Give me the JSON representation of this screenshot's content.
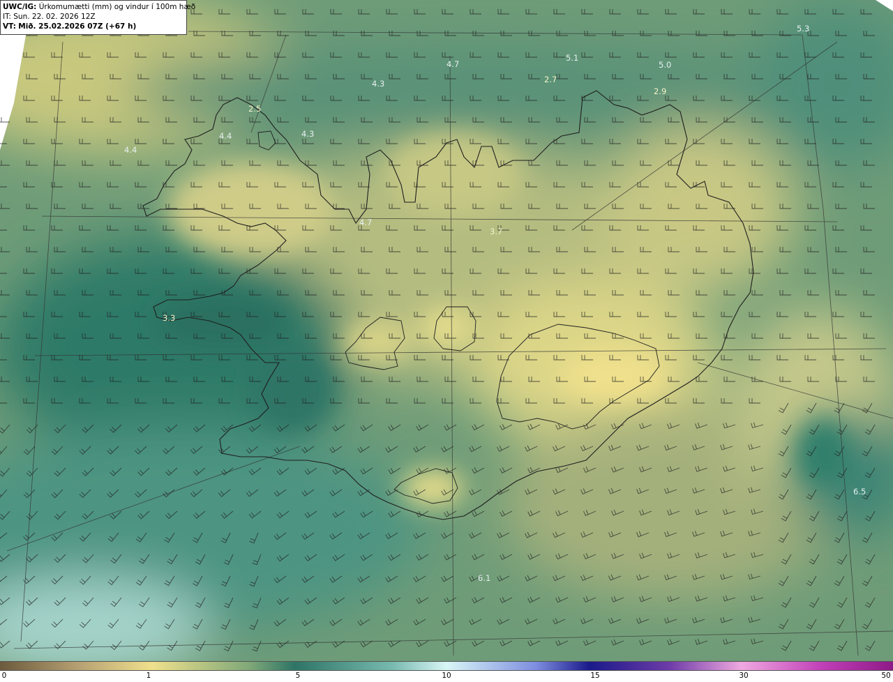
{
  "header": {
    "product": "UWC/IG:",
    "title": "Úrkomumætti (mm) og vindur í 100m hæð",
    "it_label": "IT:",
    "it_value": "Sun. 22. 02. 2026 12Z",
    "vt_label": "VT:",
    "vt_value": "Mið. 25.02.2026 07Z (+67 h)"
  },
  "map": {
    "variable": "precipitable water (mm)",
    "overlay": "wind barbs at 100m",
    "field_colors": {
      "low_dry": "#d9d488",
      "mid": "#8fae78",
      "moist": "#2f7f6c",
      "very_moist": "#cfeeee"
    },
    "coastline_color": "#222222",
    "value_labels": [
      {
        "text": "5.3",
        "color": "#e6f0f0"
      },
      {
        "text": "5.1",
        "color": "#e6f0f0"
      },
      {
        "text": "4.7",
        "color": "#e6f0f0"
      },
      {
        "text": "5.0",
        "color": "#e6f0f0"
      },
      {
        "text": "2.7",
        "color": "#f5f2c8"
      },
      {
        "text": "2.9",
        "color": "#f5f2c8"
      },
      {
        "text": "4.3",
        "color": "#e6f0f0"
      },
      {
        "text": "2.5",
        "color": "#f5f2c8"
      },
      {
        "text": "4.4",
        "color": "#e6f0f0"
      },
      {
        "text": "4.4",
        "color": "#e6f0f0"
      },
      {
        "text": "4.3",
        "color": "#e6f0f0"
      },
      {
        "text": "4.7",
        "color": "#e6f0f0"
      },
      {
        "text": "3.7",
        "color": "#f5f2c8"
      },
      {
        "text": "3.3",
        "color": "#f5f2c8"
      },
      {
        "text": "6.5",
        "color": "#e6f0f0"
      },
      {
        "text": "6.1",
        "color": "#e6f0f0"
      }
    ]
  },
  "colorbar": {
    "ticks": [
      "0",
      "1",
      "5",
      "10",
      "15",
      "30",
      "50"
    ],
    "stops": [
      {
        "color": "#6b5a3c",
        "frac": 0.0
      },
      {
        "color": "#b8a274",
        "frac": 0.09
      },
      {
        "color": "#efe08c",
        "frac": 0.17
      },
      {
        "color": "#7fa878",
        "frac": 0.28
      },
      {
        "color": "#2e7566",
        "frac": 0.33
      },
      {
        "color": "#78bab0",
        "frac": 0.44
      },
      {
        "color": "#d8f6f6",
        "frac": 0.5
      },
      {
        "color": "#7e8ee0",
        "frac": 0.6
      },
      {
        "color": "#1a1a8a",
        "frac": 0.66
      },
      {
        "color": "#6e3ca8",
        "frac": 0.75
      },
      {
        "color": "#f0a8e0",
        "frac": 0.83
      },
      {
        "color": "#c040b8",
        "frac": 0.92
      },
      {
        "color": "#8e1a88",
        "frac": 1.0
      }
    ]
  }
}
